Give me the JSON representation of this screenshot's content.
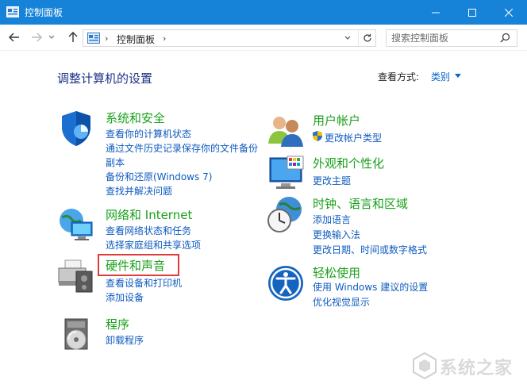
{
  "window": {
    "title": "控制面板",
    "accent_color": "#1683d8"
  },
  "nav": {
    "breadcrumb": "控制面板",
    "search_placeholder": "搜索控制面板"
  },
  "content": {
    "heading": "调整计算机的设置",
    "view_by_label": "查看方式:",
    "view_by_value": "类别"
  },
  "categories": [
    {
      "icon": "shield-icon",
      "title": "系统和安全",
      "links": [
        "查看你的计算机状态",
        "通过文件历史记录保存你的文件备份",
        "副本",
        "备份和还原(Windows 7)",
        "查找并解决问题"
      ]
    },
    {
      "icon": "network-icon",
      "title": "网络和 Internet",
      "links": [
        "查看网络状态和任务",
        "选择家庭组和共享选项"
      ]
    },
    {
      "icon": "printer-icon",
      "title": "硬件和声音",
      "links": [
        "查看设备和打印机",
        "添加设备"
      ],
      "highlighted": true
    },
    {
      "icon": "programs-icon",
      "title": "程序",
      "links": [
        "卸载程序"
      ]
    },
    {
      "icon": "users-icon",
      "title": "用户帐户",
      "links": [
        "更改帐户类型"
      ]
    },
    {
      "icon": "personalization-icon",
      "title": "外观和个性化",
      "links": [
        "更改主题"
      ]
    },
    {
      "icon": "clock-globe-icon",
      "title": "时钟、语言和区域",
      "links": [
        "添加语言",
        "更换输入法",
        "更改日期、时间或数字格式"
      ]
    },
    {
      "icon": "ease-of-access-icon",
      "title": "轻松使用",
      "links": [
        "使用 Windows 建议的设置",
        "优化视觉显示"
      ]
    }
  ],
  "watermark": {
    "text": "系统之家"
  }
}
